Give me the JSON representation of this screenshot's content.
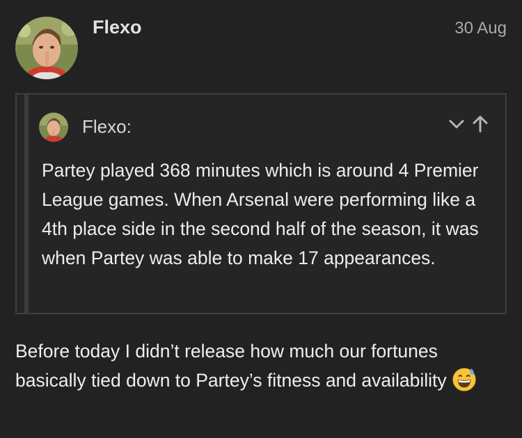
{
  "post": {
    "author": "Flexo",
    "date": "30 Aug",
    "quote": {
      "author": "Flexo:",
      "text": "Partey played 368 minutes which is around 4 Premier League games. When Arsenal were performing like a 4th place side in the second half of the season, it was when Partey was able to make 17 appearances."
    },
    "body": "Before today I didn’t release how much our fortunes basically tied down to Partey’s fitness and availability",
    "emoji": "grinning-face-with-sweat-emoji"
  },
  "icons": {
    "quote_expand": "chevron-down-icon",
    "quote_jump": "arrow-up-icon"
  },
  "colors": {
    "background": "#222222",
    "quote_border": "#3e3e3e",
    "text": "#efefef",
    "muted": "#a9a9a9"
  }
}
